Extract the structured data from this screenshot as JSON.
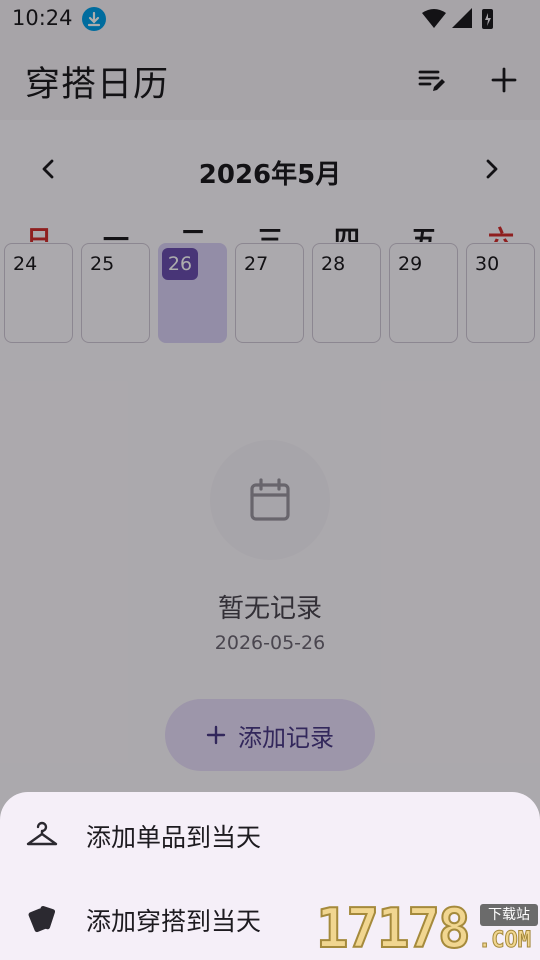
{
  "status_bar": {
    "time": "10:24"
  },
  "app_bar": {
    "title": "穿搭日历"
  },
  "calendar": {
    "month_title": "2026年5月",
    "weekdays": [
      "日",
      "一",
      "二",
      "三",
      "四",
      "五",
      "六"
    ],
    "days": [
      "24",
      "25",
      "26",
      "27",
      "28",
      "29",
      "30"
    ],
    "selected_day": "26"
  },
  "empty_state": {
    "title": "暂无记录",
    "date": "2026-05-26",
    "add_button_label": "添加记录"
  },
  "sheet": {
    "items": [
      {
        "label": "添加单品到当天",
        "icon": "hanger-icon"
      },
      {
        "label": "添加穿搭到当天",
        "icon": "cards-icon"
      }
    ]
  },
  "watermark": {
    "digits": "17178",
    "tag": "下载站",
    "suffix": ".COM"
  },
  "colors": {
    "accent": "#6a4fb0",
    "selected_bg": "#d9d0f6",
    "weekend_red": "#d32f2f",
    "sheet_bg": "#f5eff8",
    "status_download": "#00a0e9"
  }
}
